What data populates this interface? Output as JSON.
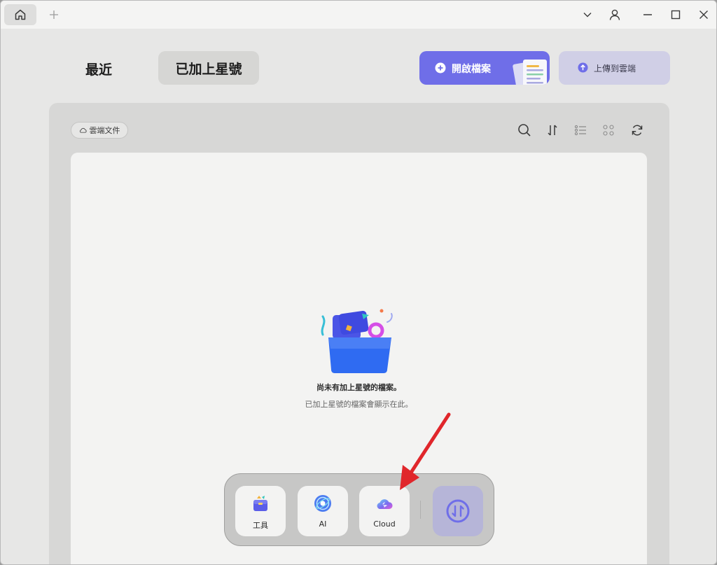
{
  "titlebar": {
    "home_icon": "home-icon",
    "new_tab_icon": "plus-icon",
    "controls": [
      "chevron-down-icon",
      "user-icon",
      "minimize-icon",
      "maximize-icon",
      "close-icon"
    ]
  },
  "header": {
    "tabs": [
      {
        "label": "最近",
        "active": false
      },
      {
        "label": "已加上星號",
        "active": true
      }
    ],
    "open_button": "開啟檔案",
    "upload_button": "上傳到雲端"
  },
  "panel": {
    "cloud_chip": "雲端文件",
    "toolbar_icons": [
      "search-icon",
      "sort-icon",
      "list-view-icon",
      "grid-view-icon",
      "refresh-icon"
    ]
  },
  "empty_state": {
    "title": "尚未有加上星號的檔案。",
    "subtitle": "已加上星號的檔案會顯示在此。"
  },
  "dock": {
    "items": [
      {
        "label": "工具",
        "icon": "toolbox-icon"
      },
      {
        "label": "AI",
        "icon": "ai-icon"
      },
      {
        "label": "Cloud",
        "icon": "cloud-icon"
      }
    ],
    "round_icon": "convert-icon"
  },
  "colors": {
    "accent": "#6f6ee8",
    "accent_soft": "#d0cfe6",
    "arrow": "#e0262b"
  }
}
